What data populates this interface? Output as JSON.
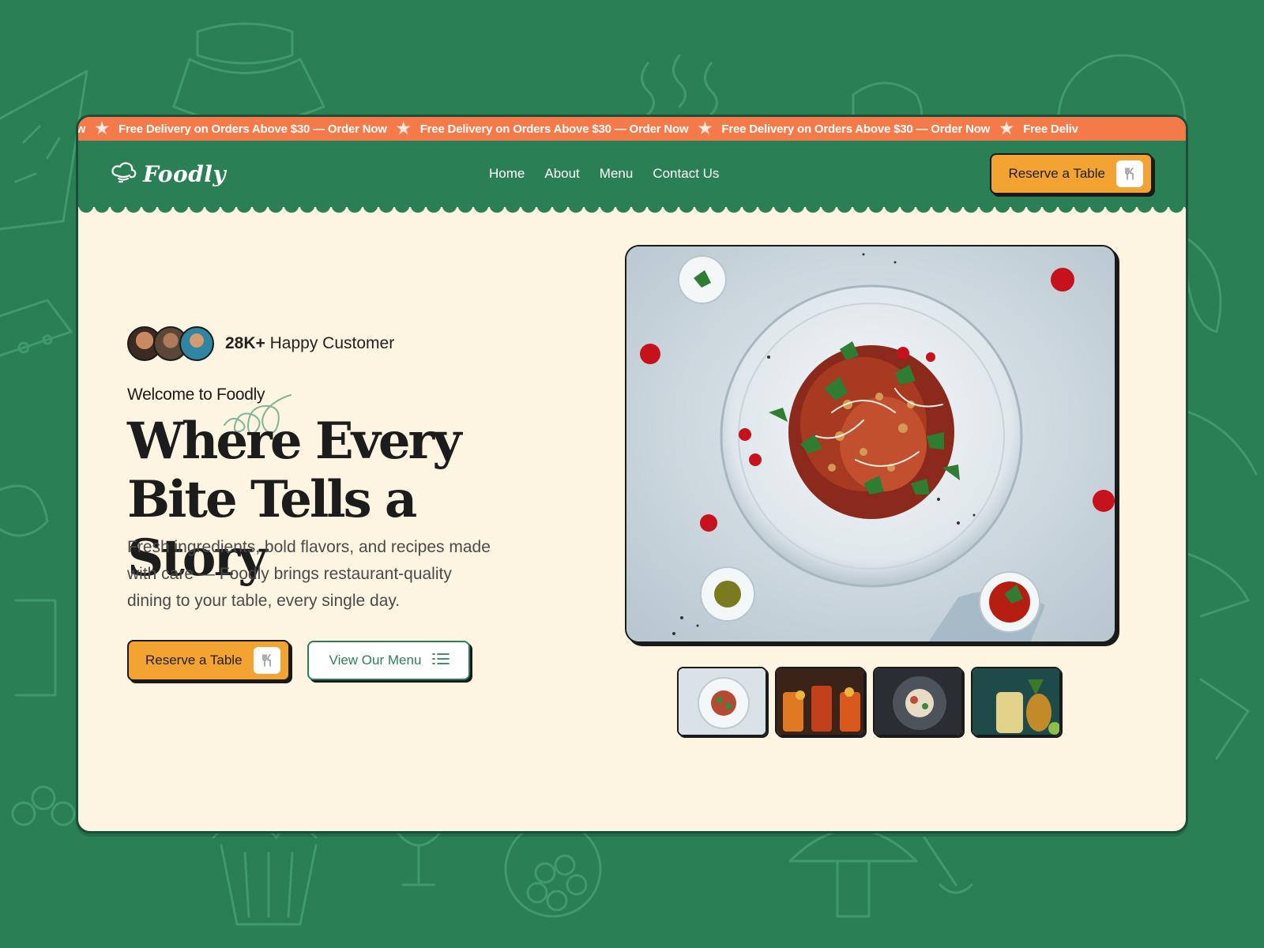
{
  "ticker": {
    "items": [
      "Now",
      "Free Delivery on Orders Above $30 — Order Now",
      "Free Delivery on Orders Above $30 — Order Now",
      "Free Delivery on Orders Above $30 — Order Now",
      "Free Deliv"
    ]
  },
  "brand": {
    "name": "Foodly"
  },
  "nav": {
    "items": [
      "Home",
      "About",
      "Menu",
      "Contact Us"
    ]
  },
  "header": {
    "cta_label": "Reserve a Table"
  },
  "hero": {
    "customers_count": "28K+",
    "customers_label": "Happy Customer",
    "welcome": "Welcome to Foodly",
    "headline_line1": "Where Every",
    "headline_line2": "Bite Tells a Story",
    "description": "Fresh ingredients, bold flavors, and recipes made with care — Foodly brings restaurant-quality dining to your table, every single day.",
    "primary_cta": "Reserve a Table",
    "secondary_cta": "View Our Menu"
  },
  "icons": {
    "logo": "chef-hat-icon",
    "reserve": "fork-knife-icon",
    "menu": "list-icon",
    "ticker_separator": "star-icon"
  },
  "colors": {
    "brand_green": "#2a7f55",
    "ticker_orange": "#f47a4a",
    "accent_orange": "#f2a331",
    "cream": "#fdf4e2",
    "ink": "#1a1a1a"
  }
}
